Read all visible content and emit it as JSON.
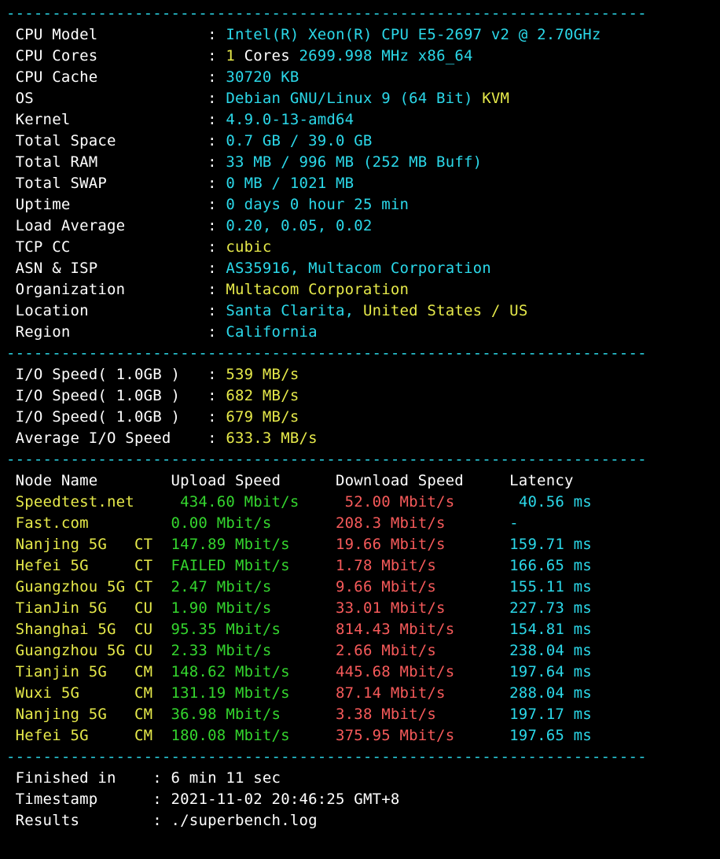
{
  "sep": "----------------------------------------------------------------------",
  "sys": {
    "lbl": {
      "cpu_model": "CPU Model",
      "cpu_cores": "CPU Cores",
      "cpu_cache": "CPU Cache",
      "os": "OS",
      "kernel": "Kernel",
      "total_space": "Total Space",
      "total_ram": "Total RAM",
      "total_swap": "Total SWAP",
      "uptime": "Uptime",
      "load_avg": "Load Average",
      "tcp_cc": "TCP CC",
      "asn_isp": "ASN & ISP",
      "org": "Organization",
      "location": "Location",
      "region": "Region"
    },
    "cpu_model": "Intel(R) Xeon(R) CPU E5-2697 v2 @ 2.70GHz",
    "cpu_cores_n": "1",
    "cpu_cores_w": "Cores",
    "cpu_freq_arch": "2699.998 MHz x86_64",
    "cpu_cache": "30720 KB",
    "os_name": "Debian GNU/Linux 9 (64 Bit)",
    "os_virt": "KVM",
    "kernel": "4.9.0-13-amd64",
    "total_space": "0.7 GB / 39.0 GB",
    "total_ram": "33 MB / 996 MB (252 MB Buff)",
    "total_swap": "0 MB / 1021 MB",
    "uptime": "0 days 0 hour 25 min",
    "load_avg": "0.20, 0.05, 0.02",
    "tcp_cc": "cubic",
    "asn_isp": "AS35916, Multacom Corporation",
    "org": "Multacom Corporation",
    "loc_city": "Santa Clarita,",
    "loc_country": "United States / US",
    "region": "California"
  },
  "io": {
    "lbl_speed": "I/O Speed( 1.0GB )",
    "lbl_avg": "Average I/O Speed",
    "r1": "539 MB/s",
    "r2": "682 MB/s",
    "r3": "679 MB/s",
    "avg": "633.3 MB/s"
  },
  "net": {
    "hdr": {
      "node": "Node Name",
      "up": "Upload Speed",
      "down": "Download Speed",
      "lat": "Latency"
    },
    "rows": [
      {
        "node": "Speedtest.net",
        "isp": "",
        "up": "434.60 Mbit/s",
        "down": "52.00 Mbit/s",
        "lat": "40.56 ms"
      },
      {
        "node": "Fast.com",
        "isp": "",
        "up": "0.00 Mbit/s",
        "down": "208.3 Mbit/s",
        "lat": "-"
      },
      {
        "node": "Nanjing 5G",
        "isp": "CT",
        "up": "147.89 Mbit/s",
        "down": "19.66 Mbit/s",
        "lat": "159.71 ms"
      },
      {
        "node": "Hefei 5G",
        "isp": "CT",
        "up": "FAILED Mbit/s",
        "down": "1.78 Mbit/s",
        "lat": "166.65 ms"
      },
      {
        "node": "Guangzhou 5G",
        "isp": "CT",
        "up": "2.47 Mbit/s",
        "down": "9.66 Mbit/s",
        "lat": "155.11 ms"
      },
      {
        "node": "TianJin 5G",
        "isp": "CU",
        "up": "1.90 Mbit/s",
        "down": "33.01 Mbit/s",
        "lat": "227.73 ms"
      },
      {
        "node": "Shanghai 5G",
        "isp": "CU",
        "up": "95.35 Mbit/s",
        "down": "814.43 Mbit/s",
        "lat": "154.81 ms"
      },
      {
        "node": "Guangzhou 5G",
        "isp": "CU",
        "up": "2.33 Mbit/s",
        "down": "2.66 Mbit/s",
        "lat": "238.04 ms"
      },
      {
        "node": "Tianjin 5G",
        "isp": "CM",
        "up": "148.62 Mbit/s",
        "down": "445.68 Mbit/s",
        "lat": "197.64 ms"
      },
      {
        "node": "Wuxi 5G",
        "isp": "CM",
        "up": "131.19 Mbit/s",
        "down": "87.14 Mbit/s",
        "lat": "288.04 ms"
      },
      {
        "node": "Nanjing 5G",
        "isp": "CM",
        "up": "36.98 Mbit/s",
        "down": "3.38 Mbit/s",
        "lat": "197.17 ms"
      },
      {
        "node": "Hefei 5G",
        "isp": "CM",
        "up": "180.08 Mbit/s",
        "down": "375.95 Mbit/s",
        "lat": "197.65 ms"
      }
    ]
  },
  "footer": {
    "lbl": {
      "finished": "Finished in",
      "timestamp": "Timestamp",
      "results": "Results"
    },
    "finished": "6 min 11 sec",
    "timestamp": "2021-11-02 20:46:25 GMT+8",
    "results": "./superbench.log"
  }
}
